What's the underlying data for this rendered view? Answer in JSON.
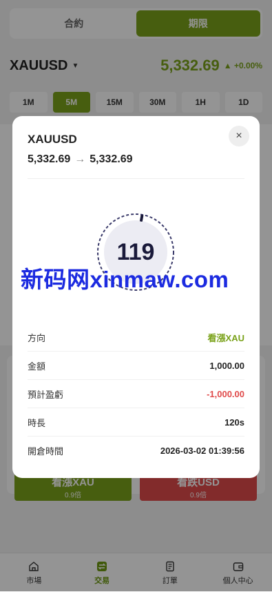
{
  "tabs": [
    "合約",
    "期限"
  ],
  "symbol": {
    "name": "XAUUSD",
    "price": "5,332.69",
    "change": "+0.00%"
  },
  "timeframes": [
    "1M",
    "5M",
    "15M",
    "30M",
    "1H",
    "1D"
  ],
  "trade_buttons": {
    "up": {
      "label": "看漲XAU",
      "multiplier": "0.9倍"
    },
    "down": {
      "label": "看跌USD",
      "multiplier": "0.9倍"
    }
  },
  "nav": [
    "市場",
    "交易",
    "訂單",
    "個人中心"
  ],
  "modal": {
    "title": "XAUUSD",
    "open_price": "5,332.69",
    "arrow": "→",
    "current_price": "5,332.69",
    "close": "×",
    "countdown": "119",
    "rows": [
      {
        "label": "方向",
        "value": "看漲XAU"
      },
      {
        "label": "金額",
        "value": "1,000.00"
      },
      {
        "label": "預計盈虧",
        "value": "-1,000.00"
      },
      {
        "label": "時長",
        "value": "120s"
      },
      {
        "label": "開倉時間",
        "value": "2026-03-02 01:39:56"
      }
    ]
  },
  "watermark": "新码网xinmaw.com",
  "colors": {
    "accent_green": "#7aa21a",
    "loss_red": "#e04a4a",
    "watermark_blue": "#1c2be0"
  },
  "icons": [
    "chevron-down-icon",
    "close-icon",
    "home-icon",
    "exchange-icon",
    "document-icon",
    "wallet-icon"
  ]
}
